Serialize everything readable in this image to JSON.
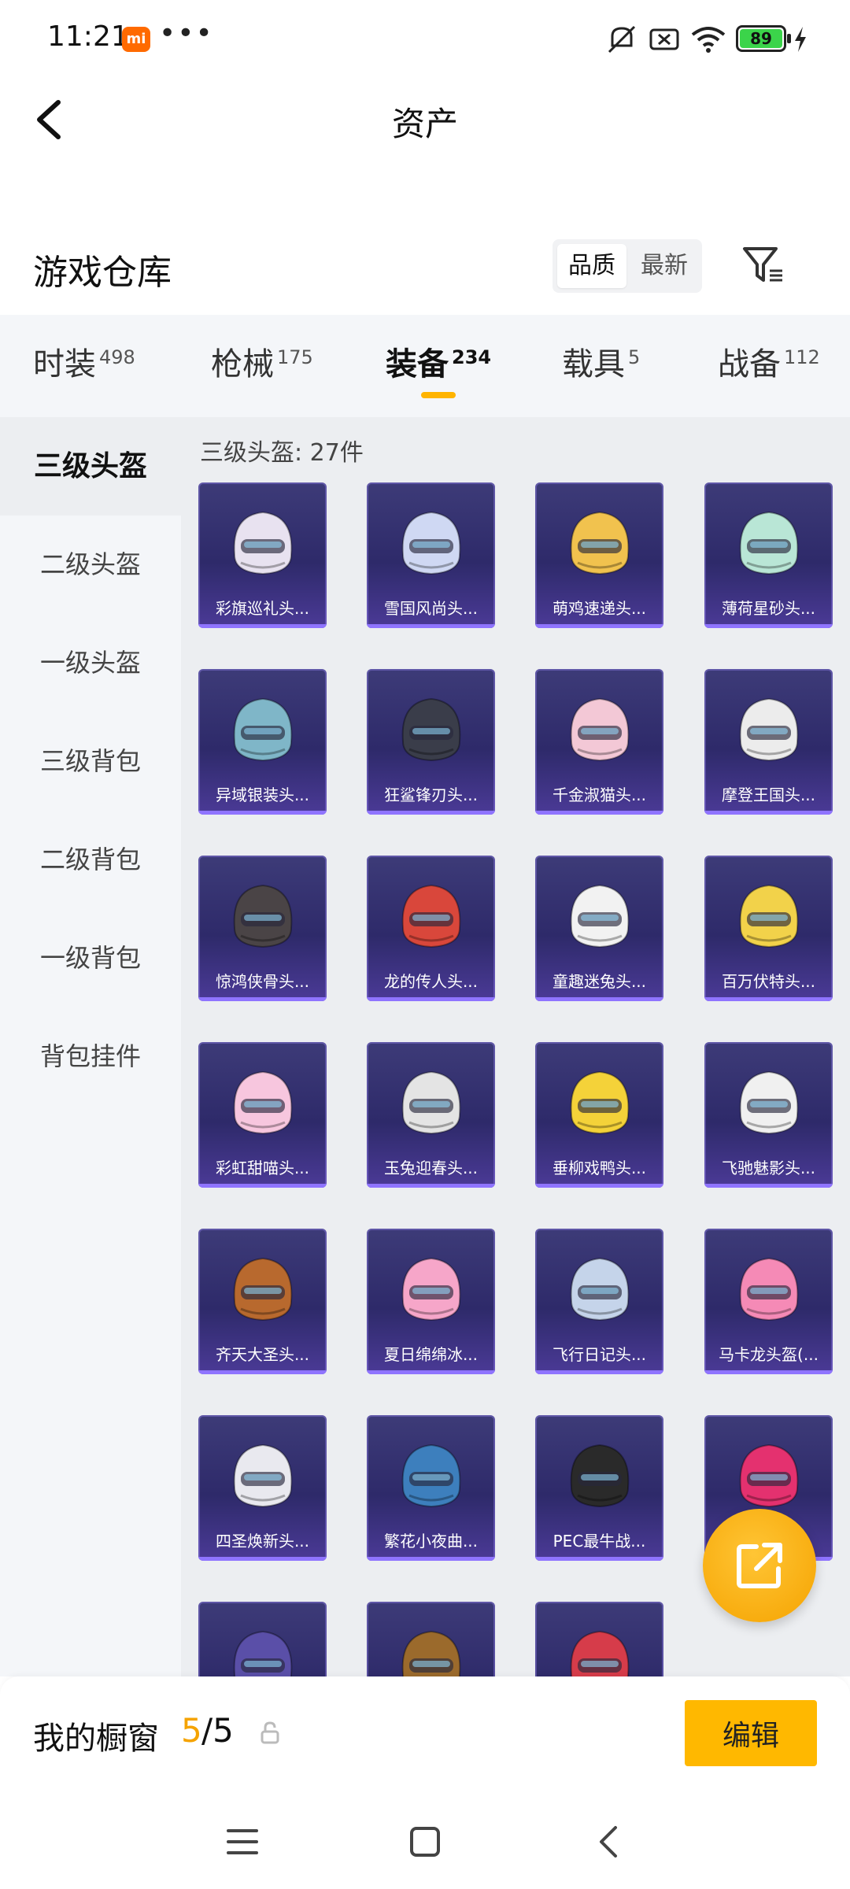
{
  "status_bar": {
    "time": "11:21",
    "carrier_badge": "mi",
    "more": "•••",
    "battery": "89"
  },
  "header": {
    "title": "资产",
    "back_icon": "chevron-left-icon"
  },
  "section": {
    "title": "游戏仓库",
    "sort_options": [
      "品质",
      "最新"
    ],
    "filter_icon": "filter-icon"
  },
  "tabs": [
    {
      "label": "时装",
      "count": "498"
    },
    {
      "label": "枪械",
      "count": "175"
    },
    {
      "label": "装备",
      "count": "234"
    },
    {
      "label": "载具",
      "count": "5"
    },
    {
      "label": "战备",
      "count": "112"
    }
  ],
  "sidebar": {
    "items": [
      "三级头盔",
      "二级头盔",
      "一级头盔",
      "三级背包",
      "二级背包",
      "一级背包",
      "背包挂件"
    ]
  },
  "content": {
    "count_text": "三级头盔: 27件",
    "items": [
      "彩旗巡礼头...",
      "雪国风尚头...",
      "萌鸡速递头...",
      "薄荷星砂头...",
      "异域银装头...",
      "狂鲨锋刃头...",
      "千金淑猫头...",
      "摩登王国头...",
      "惊鸿侠骨头...",
      "龙的传人头...",
      "童趣迷兔头...",
      "百万伏特头...",
      "彩虹甜喵头...",
      "玉兔迎春头...",
      "垂柳戏鸭头...",
      "飞驰魅影头...",
      "齐天大圣头...",
      "夏日绵绵冰...",
      "飞行日记头...",
      "马卡龙头盔(...",
      "四圣焕新头...",
      "繁花小夜曲...",
      "PEC最牛战...",
      "",
      "",
      "",
      ""
    ],
    "helmet_colors": [
      "#e8e2f0",
      "#cfd8f3",
      "#f1c24e",
      "#b9e6d6",
      "#7fb6c8",
      "#3a3d4a",
      "#f3c8d6",
      "#ececec",
      "#4a4446",
      "#d9473b",
      "#f2f2f2",
      "#f2d24a",
      "#f7c6de",
      "#e4e4e4",
      "#f4d239",
      "#f0f0f0",
      "#b8692e",
      "#f6a6c9",
      "#c5d4ea",
      "#f58ab6",
      "#e9e9ef",
      "#3d7fbd",
      "#2a2a2a",
      "#e4316f",
      "#5a4fa8",
      "#9b6a2c",
      "#d63c4a"
    ]
  },
  "floating_button": {
    "icon": "share-icon"
  },
  "bottom_bar": {
    "title": "我的橱窗",
    "used": "5",
    "total": "/5",
    "lock_icon": "lock-icon",
    "edit_label": "编辑"
  },
  "system_nav": [
    "menu-icon",
    "home-icon",
    "back-icon"
  ]
}
